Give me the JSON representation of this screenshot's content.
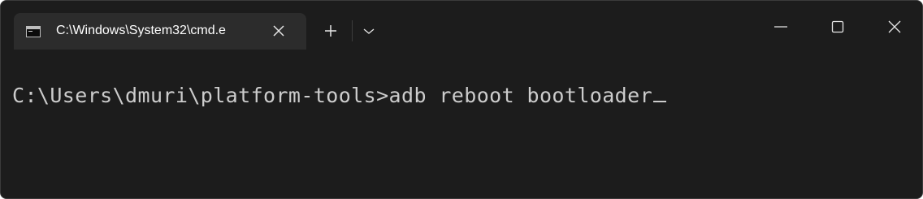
{
  "window": {
    "tab_title": "C:\\Windows\\System32\\cmd.e",
    "tab_icon": "cmd-icon",
    "controls": {
      "close_tab_icon": "close-icon",
      "new_tab_icon": "plus-icon",
      "dropdown_icon": "chevron-down-icon",
      "minimize_icon": "minimize-icon",
      "maximize_icon": "maximize-icon",
      "close_window_icon": "close-icon"
    }
  },
  "terminal": {
    "prompt": "C:\\Users\\dmuri\\platform-tools>",
    "command": "adb reboot bootloader"
  },
  "colors": {
    "background": "#1c1c1c",
    "tab_background": "#2c2c2c",
    "text": "#cccccc",
    "tab_text": "#ffffff"
  }
}
